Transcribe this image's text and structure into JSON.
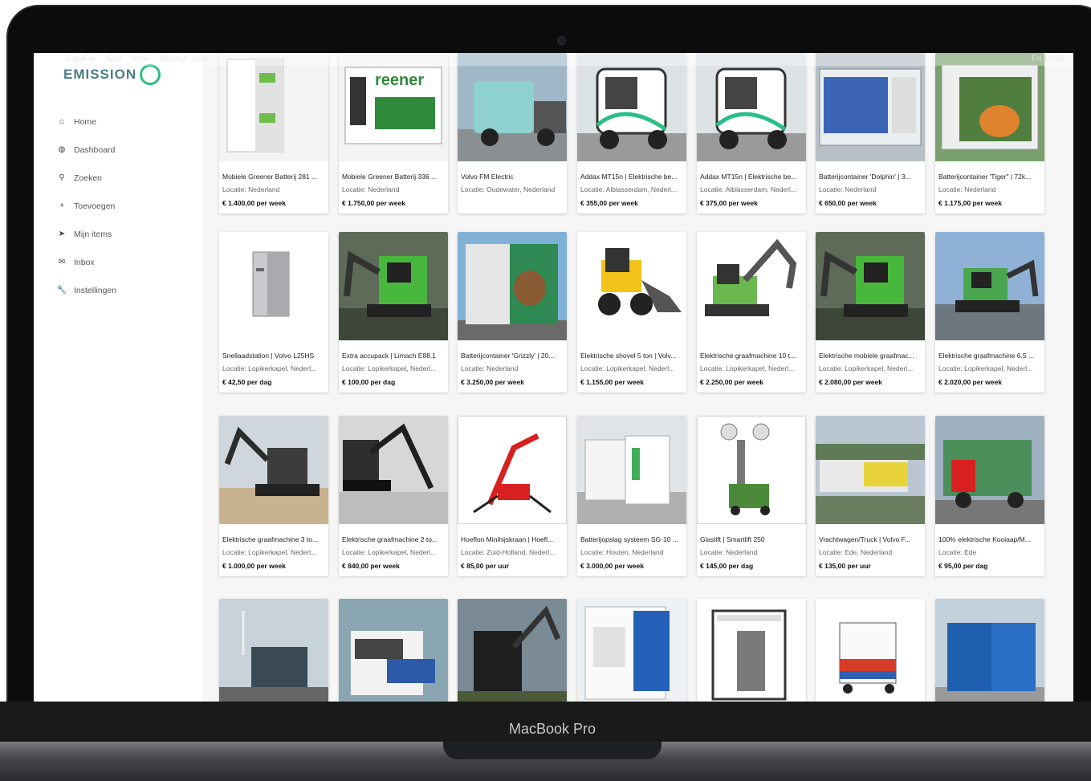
{
  "device": {
    "label": "MacBook Pro"
  },
  "menubar": {
    "items": [
      "Edge",
      "File",
      "Edit",
      "View",
      "Window",
      "Help"
    ],
    "clock": "Fri 12:50"
  },
  "app": {
    "logo_text": "EMISSION"
  },
  "sidebar": {
    "items": [
      {
        "label": "Home",
        "icon": "home-icon",
        "glyph": "⌂"
      },
      {
        "label": "Dashboard",
        "icon": "dashboard-icon",
        "glyph": "◍"
      },
      {
        "label": "Zoeken",
        "icon": "search-icon",
        "glyph": "⚲"
      },
      {
        "label": "Toevoegen",
        "icon": "plus-icon",
        "glyph": "+"
      },
      {
        "label": "Mijn items",
        "icon": "send-icon",
        "glyph": "➤"
      },
      {
        "label": "Inbox",
        "icon": "mail-icon",
        "glyph": "✉"
      },
      {
        "label": "Instellingen",
        "icon": "wrench-icon",
        "glyph": "🔧"
      }
    ]
  },
  "listings": [
    {
      "title": "Mobiele Greener Batterij 281 ...",
      "location": "Locatie: Nederland",
      "price": "€ 1.400,00 per week",
      "img": "battery-white"
    },
    {
      "title": "Mobiele Greener Batterij 336 ...",
      "location": "Locatie: Nederland",
      "price": "€ 1.750,00 per week",
      "img": "battery-greener"
    },
    {
      "title": "Volvo FM Electric",
      "location": "Locatie: Oudewater, Nederland",
      "price": "",
      "img": "truck-teal"
    },
    {
      "title": "Addax MT15n | Elektrische be...",
      "location": "Locatie: Alblasserdam, Nederl...",
      "price": "€ 355,00 per week",
      "img": "utility-cart"
    },
    {
      "title": "Addax MT15n | Elektrische be...",
      "location": "Locatie: Alblasserdam, Nederl...",
      "price": "€ 375,00 per week",
      "img": "utility-cart"
    },
    {
      "title": "Batterijcontainer 'Dolphin' | 3...",
      "location": "Locatie: Nederland",
      "price": "€ 650,00 per week",
      "img": "container-blue"
    },
    {
      "title": "Batterijcontainer 'Tiger\" | 72k...",
      "location": "Locatie: Nederland",
      "price": "€ 1.175,00 per week",
      "img": "container-tiger"
    },
    {
      "title": "Snellaadstation | Volvo L25HS",
      "location": "Locatie: Lopikerkapel, Nederl...",
      "price": "€ 42,50 per dag",
      "img": "charger-grey"
    },
    {
      "title": "Extra accupack | Limach E88.1",
      "location": "Locatie: Lopikerkapel, Nederl...",
      "price": "€ 100,00 per dag",
      "img": "excavator-green"
    },
    {
      "title": "Batterijcontainer 'Grizzly' | 20...",
      "location": "Locatie: Nederland",
      "price": "€ 3.250,00 per week",
      "img": "container-bear"
    },
    {
      "title": "Elektrische shovel 5 ton | Volv...",
      "location": "Locatie: Lopikerkapel, Nederl...",
      "price": "€ 1.155,00 per week",
      "img": "loader-yellow"
    },
    {
      "title": "Elektrische graafmachine 10 t...",
      "location": "Locatie: Lopikerkapel, Nederl...",
      "price": "€ 2.250,00 per week",
      "img": "excavator-grey"
    },
    {
      "title": "Elektrische mobiele graafmac...",
      "location": "Locatie: Lopikerkapel, Nederl...",
      "price": "€ 2.080,00 per week",
      "img": "excavator-green"
    },
    {
      "title": "Elektrische graafmachine 6.5 ...",
      "location": "Locatie: Lopikerkapel, Nederl...",
      "price": "€ 2.020,00 per week",
      "img": "excavator-sky"
    },
    {
      "title": "Elektrische graafmachine 3 to...",
      "location": "Locatie: Lopikerkapel, Nederl...",
      "price": "€ 1.000,00 per week",
      "img": "excavator-sand"
    },
    {
      "title": "Elektrische graafmachine 2 to...",
      "location": "Locatie: Lopikerkapel, Nederl...",
      "price": "€ 840,00 per week",
      "img": "excavator-hall"
    },
    {
      "title": "Hoeflon Minihijskraan | Hoefl...",
      "location": "Locatie: Zuid-Holland, Nederl...",
      "price": "€ 85,00 per uur",
      "img": "crane-red"
    },
    {
      "title": "Batterijopslag systeem SG-10 ...",
      "location": "Locatie: Houten, Nederland",
      "price": "€ 3.000,00 per week",
      "img": "battery-boxes"
    },
    {
      "title": "Glaslift | Smartlift 250",
      "location": "Locatie: Nederland",
      "price": "€ 145,00 per dag",
      "img": "glasslift"
    },
    {
      "title": "Vrachtwagen/Truck | Volvo F...",
      "location": "Locatie: Ede, Nederland",
      "price": "€ 135,00 per uur",
      "img": "truck-yellow"
    },
    {
      "title": "100% elektrische Kooiaap/M...",
      "location": "Locatie: Ede",
      "price": "€ 95,00 per dag",
      "img": "truck-green"
    },
    {
      "title": "",
      "location": "",
      "price": "",
      "img": "truck-wind"
    },
    {
      "title": "",
      "location": "",
      "price": "",
      "img": "truck-white"
    },
    {
      "title": "",
      "location": "",
      "price": "",
      "img": "excavator-dark"
    },
    {
      "title": "",
      "location": "",
      "price": "",
      "img": "charger-blue"
    },
    {
      "title": "",
      "location": "",
      "price": "",
      "img": "cabin-frame"
    },
    {
      "title": "",
      "location": "",
      "price": "",
      "img": "charger-cart"
    },
    {
      "title": "",
      "location": "",
      "price": "",
      "img": "container-blue-small"
    }
  ],
  "colors": {
    "accent": "#2bbf87",
    "logo": "#4a7d86"
  }
}
